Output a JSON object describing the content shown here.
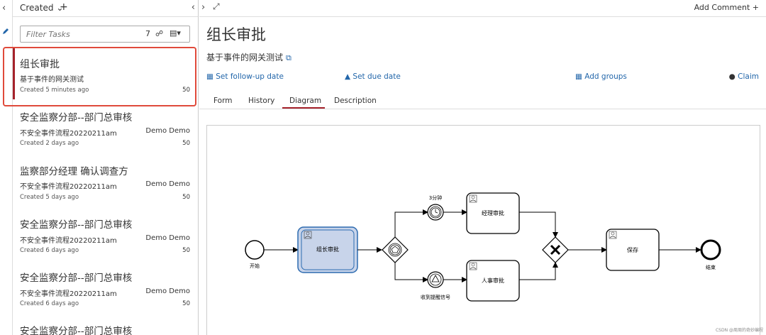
{
  "sidebar": {
    "filter_label": "Created",
    "filter_placeholder": "Filter Tasks",
    "task_count": "7",
    "tasks": [
      {
        "title": "组长审批",
        "process": "基于事件的网关测试",
        "assignee": "",
        "age": "Created 5 minutes ago",
        "priority": "50"
      },
      {
        "title": "安全监察分部--部门总审核",
        "process": "不安全事件流程20220211am",
        "assignee": "Demo Demo",
        "age": "Created 2 days ago",
        "priority": "50"
      },
      {
        "title": "监察部分经理 确认调查方",
        "process": "不安全事件流程20220211am",
        "assignee": "Demo Demo",
        "age": "Created 5 days ago",
        "priority": "50"
      },
      {
        "title": "安全监察分部--部门总审核",
        "process": "不安全事件流程20220211am",
        "assignee": "Demo Demo",
        "age": "Created 6 days ago",
        "priority": "50"
      },
      {
        "title": "安全监察分部--部门总审核",
        "process": "不安全事件流程20220211am",
        "assignee": "Demo Demo",
        "age": "Created 6 days ago",
        "priority": "50"
      },
      {
        "title": "安全监察分部--部门总审核",
        "process": "",
        "assignee": "",
        "age": "",
        "priority": ""
      }
    ]
  },
  "header": {
    "add_comment": "Add Comment +"
  },
  "task": {
    "title": "组长审批",
    "process": "基于事件的网关测试"
  },
  "actions": {
    "follow_up": "Set follow-up date",
    "due": "Set due date",
    "groups": "Add groups",
    "claim": "Claim"
  },
  "tabs": [
    "Form",
    "History",
    "Diagram",
    "Description"
  ],
  "active_tab": "Diagram",
  "diagram": {
    "start": "开始",
    "active_task": "组长审批",
    "timer_label": "3分钟",
    "signal_label": "收到提醒信号",
    "manager_task": "经理审批",
    "hr_task": "人事审批",
    "save_task": "保存",
    "end": "结束"
  },
  "watermark": "CSDN @周周的奇妙编程"
}
